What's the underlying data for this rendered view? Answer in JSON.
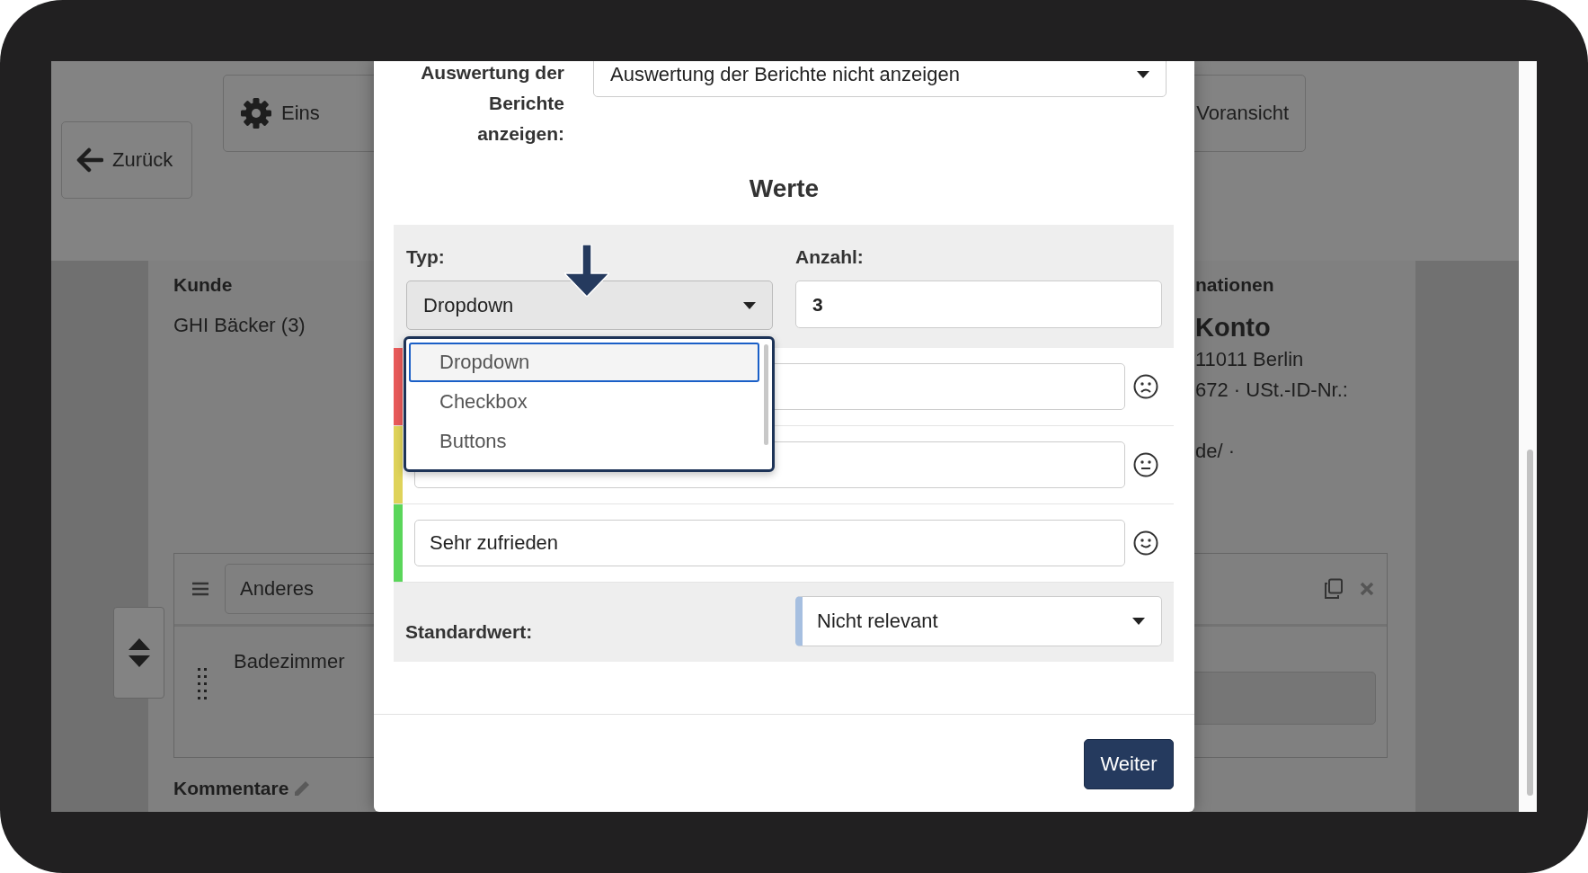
{
  "page": {
    "back_button": "Zurück",
    "settings_button": "Eins",
    "preview_button": "Voransicht",
    "customer": {
      "heading": "Kunde",
      "value": "GHI Bäcker (3)"
    },
    "info": {
      "heading": "nationen",
      "title": "Konto",
      "lines": [
        "11011 Berlin",
        "672 · USt.-ID-Nr.:",
        "de/ ·"
      ]
    },
    "block": {
      "category": "Anderes",
      "room": "Badezimmer"
    },
    "comments_heading": "Kommentare"
  },
  "modal": {
    "report_label": "Auswertung der Berichte anzeigen:",
    "report_select": "Auswertung der Berichte nicht anzeigen",
    "section_title": "Werte",
    "type_label": "Typ:",
    "type_value": "Dropdown",
    "count_label": "Anzahl:",
    "count_value": "3",
    "type_options": [
      {
        "label": "Dropdown",
        "selected": true
      },
      {
        "label": "Checkbox",
        "selected": false
      },
      {
        "label": "Buttons",
        "selected": false
      }
    ],
    "values": [
      {
        "kind": "sad",
        "color": "#e85a5a"
      },
      {
        "kind": "neutral",
        "color": "#dfd35a"
      },
      {
        "kind": "happy",
        "color": "#5ad65a",
        "value": "Sehr zufrieden"
      }
    ],
    "default_label": "Standardwert:",
    "default_value": "Nicht relevant",
    "next_button": "Weiter"
  }
}
